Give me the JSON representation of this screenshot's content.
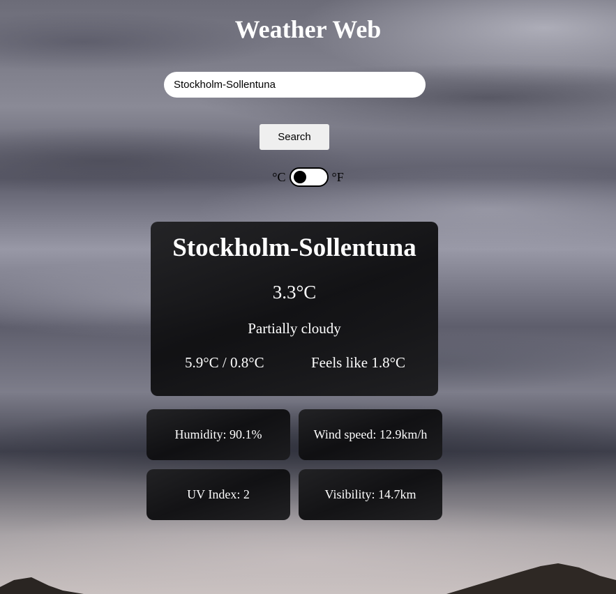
{
  "app": {
    "title": "Weather Web"
  },
  "search": {
    "value": "Stockholm-Sollentuna",
    "button_label": "Search"
  },
  "unit_toggle": {
    "celsius_label": "°C",
    "fahrenheit_label": "°F",
    "selected": "°C"
  },
  "current": {
    "city": "Stockholm-Sollentuna",
    "temperature": "3.3°C",
    "condition": "Partially cloudy",
    "min_max": "5.9°C / 0.8°C",
    "feels_like": "Feels like 1.8°C"
  },
  "stats": {
    "humidity": "Humidity: 90.1%",
    "wind_speed": "Wind speed: 12.9km/h",
    "uv_index": "UV Index: 2",
    "visibility": "Visibility: 14.7km"
  },
  "colors": {
    "card_background": "#141416",
    "text": "#ffffff",
    "input_background": "#ffffff",
    "button_background": "#efefef"
  }
}
